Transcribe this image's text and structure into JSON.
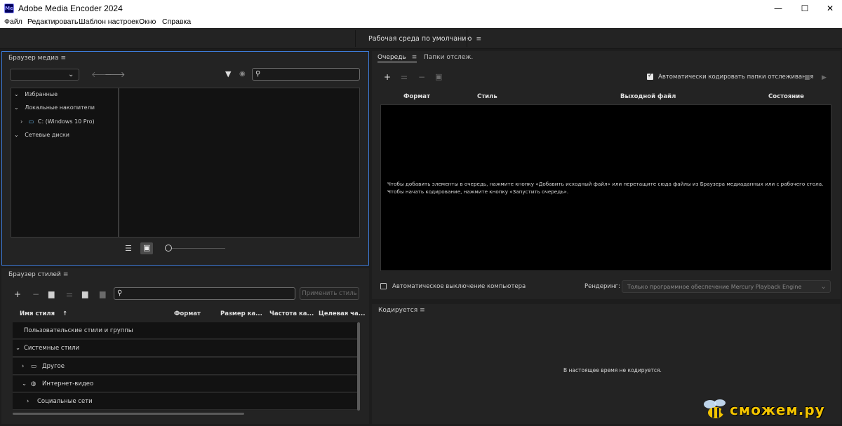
{
  "window": {
    "app_logo": "Me",
    "title": "Adobe Media Encoder 2024",
    "minimize": "—",
    "maximize": "☐",
    "close": "✕"
  },
  "menu": [
    "Файл",
    "Редактировать",
    "Шаблон настроек",
    "Окно",
    "Справка"
  ],
  "workspace": {
    "label": "Рабочая среда по умолчанию",
    "menu_icon": "≡"
  },
  "media_browser": {
    "title": "Браузер медиа",
    "menu_icon": "≡",
    "tree": [
      {
        "label": "Избранные",
        "expanded": true
      },
      {
        "label": "Локальные накопители",
        "expanded": true
      },
      {
        "label": "C: (Windows 10 Pro)",
        "expanded": false
      },
      {
        "label": "Сетевые диски",
        "expanded": true
      }
    ]
  },
  "preset_browser": {
    "title": "Браузер стилей",
    "menu_icon": "≡",
    "apply_label": "Применить стиль",
    "columns": [
      "Имя стиля",
      "Формат",
      "Размер ка...",
      "Частота ка...",
      "Целевая ча..."
    ],
    "sort_indicator": "↑",
    "rows": [
      {
        "label": "Пользовательские стили и группы"
      },
      {
        "label": "Системные стили"
      },
      {
        "label": "Другое"
      },
      {
        "label": "Интернет-видео"
      },
      {
        "label": "Социальные сети"
      }
    ]
  },
  "queue": {
    "tab_queue": "Очередь",
    "tab_watch": "Папки отслеж.",
    "auto_encode_label": "Автоматически кодировать папки отслеживания",
    "auto_encode_checked": true,
    "columns": [
      "Формат",
      "Стиль",
      "Выходной файл",
      "Состояние"
    ],
    "empty_line1": "Чтобы добавить элементы в очередь, нажмите кнопку «Добавить исходный файл» или перетащите сюда файлы из Браузера медиаданных или с рабочего стола.",
    "empty_line2": "Чтобы начать кодирование, нажмите кнопку «Запустить очередь».",
    "auto_shutdown_label": "Автоматическое выключение компьютера",
    "auto_shutdown_checked": false,
    "render_label": "Рендеринг:",
    "render_value": "Только программное обеспечение Mercury Playback Engine"
  },
  "encoding": {
    "title": "Кодируется",
    "menu_icon": "≡",
    "status": "В настоящее время не кодируется."
  },
  "watermark": {
    "text": "сможем.ру"
  }
}
